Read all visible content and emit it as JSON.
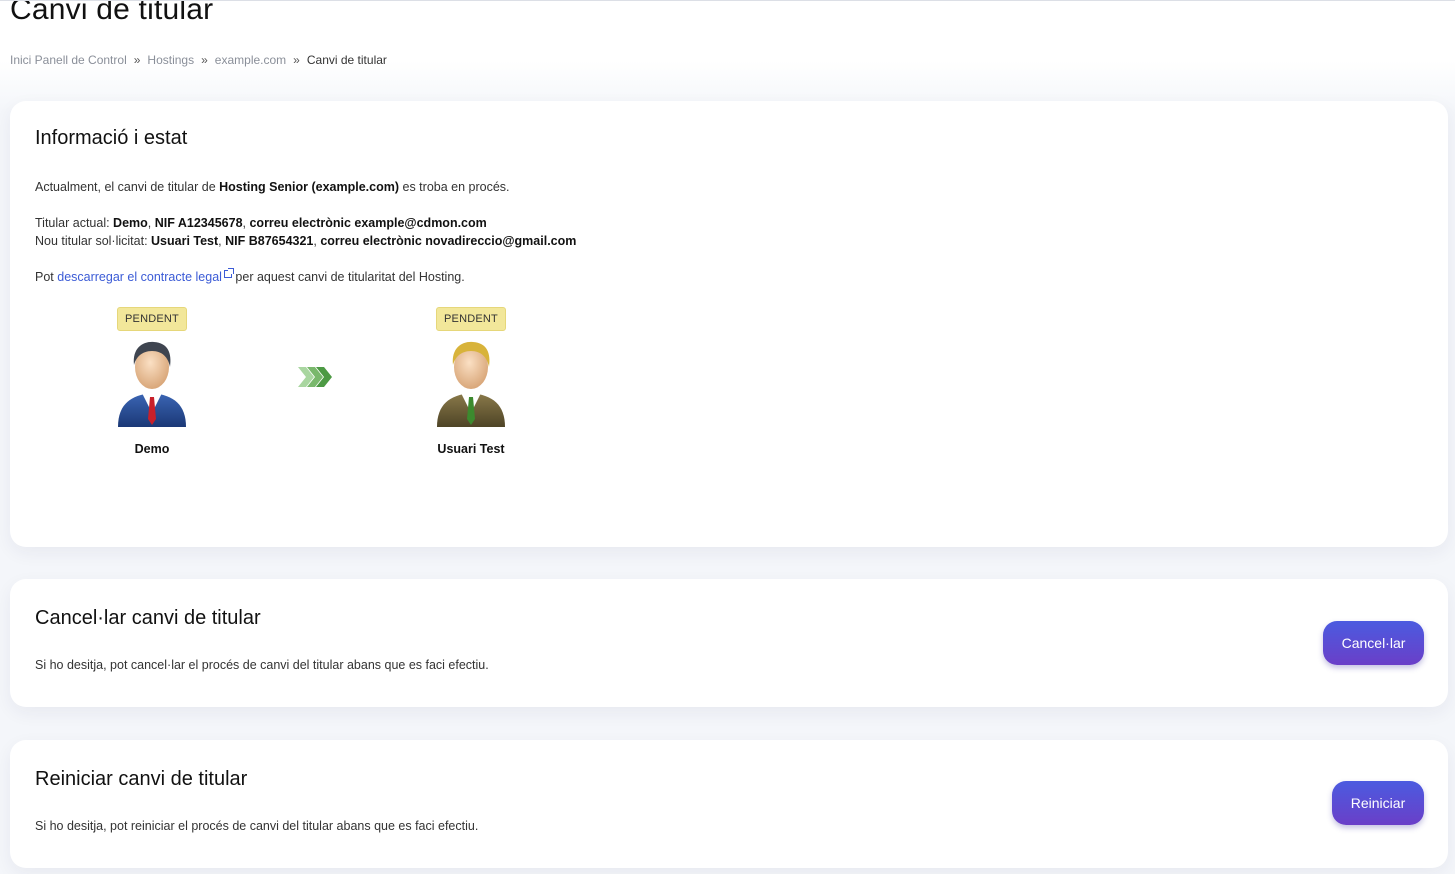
{
  "page": {
    "title": "Canvi de titular"
  },
  "breadcrumb": {
    "items": [
      "Inici Panell de Control",
      "Hostings",
      "example.com"
    ],
    "separator": "»",
    "current": "Canvi de titular"
  },
  "info": {
    "heading": "Informació i estat",
    "status_prefix": "Actualment, el canvi de titular de ",
    "service": "Hosting Senior (example.com)",
    "status_suffix": " es troba en procés.",
    "current_label": "Titular actual: ",
    "current_name": "Demo",
    "current_nif": "NIF A12345678",
    "current_email": "correu electrònic example@cdmon.com",
    "new_label": "Nou titular sol·licitat: ",
    "new_name": "Usuari Test",
    "new_nif": "NIF B87654321",
    "new_email": "correu electrònic novadireccio@gmail.com",
    "contract_prefix": "Pot ",
    "contract_link": "descarregar el contracte legal",
    "contract_suffix": " per aquest canvi de titularitat del Hosting."
  },
  "transfer": {
    "from": {
      "name": "Demo",
      "status": "PENDENT"
    },
    "to": {
      "name": "Usuari Test",
      "status": "PENDENT"
    }
  },
  "cancel": {
    "heading": "Cancel·lar canvi de titular",
    "description": "Si ho desitja, pot cancel·lar el procés de canvi del titular abans que es faci efectiu.",
    "button_label": "Cancel·lar"
  },
  "restart": {
    "heading": "Reiniciar canvi de titular",
    "description": "Si ho desitja, pot reiniciar el procés de canvi del titular abans que es faci efectiu.",
    "button_label": "Reiniciar"
  },
  "colors": {
    "button_gradient_start": "#4b5be0",
    "button_gradient_end": "#6a3fc8",
    "badge_pending": "#f2e79a",
    "link": "#3b5bd6"
  },
  "icons": {
    "from_avatar": "businessman-blue-suit-icon",
    "to_avatar": "businessman-olive-suit-icon",
    "transfer_arrow": "triple-chevron-right-icon",
    "external_link": "external-link-icon"
  }
}
